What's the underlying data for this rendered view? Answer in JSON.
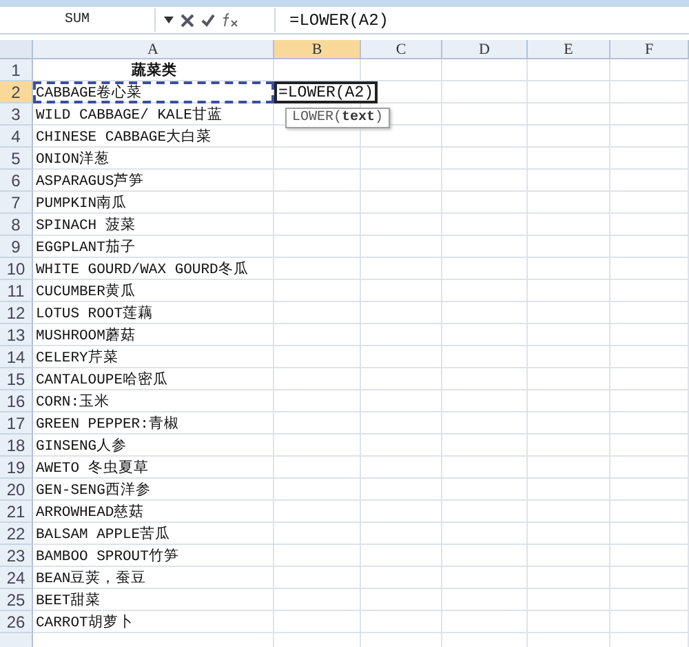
{
  "formula_bar": {
    "name_box": "SUM",
    "formula": "=LOWER(A2)"
  },
  "columns": [
    {
      "label": "A",
      "selected": false
    },
    {
      "label": "B",
      "selected": true
    },
    {
      "label": "C",
      "selected": false
    },
    {
      "label": "D",
      "selected": false
    },
    {
      "label": "E",
      "selected": false
    },
    {
      "label": "F",
      "selected": false
    }
  ],
  "rows": [
    {
      "number": "1",
      "selected": false,
      "referenced": false,
      "a": "蔬菜类",
      "heading": true
    },
    {
      "number": "2",
      "selected": true,
      "referenced": true,
      "a": "CABBAGE卷心菜",
      "b": "=LOWER(A2)",
      "heading": false
    },
    {
      "number": "3",
      "selected": false,
      "referenced": false,
      "a": "WILD CABBAGE/ KALE甘蓝",
      "heading": false
    },
    {
      "number": "4",
      "selected": false,
      "referenced": false,
      "a": "CHINESE CABBAGE大白菜",
      "heading": false
    },
    {
      "number": "5",
      "selected": false,
      "referenced": false,
      "a": "ONION洋葱",
      "heading": false
    },
    {
      "number": "6",
      "selected": false,
      "referenced": false,
      "a": "ASPARAGUS芦笋",
      "heading": false
    },
    {
      "number": "7",
      "selected": false,
      "referenced": false,
      "a": "PUMPKIN南瓜",
      "heading": false
    },
    {
      "number": "8",
      "selected": false,
      "referenced": false,
      "a": "SPINACH 菠菜",
      "heading": false
    },
    {
      "number": "9",
      "selected": false,
      "referenced": false,
      "a": "EGGPLANT茄子",
      "heading": false
    },
    {
      "number": "10",
      "selected": false,
      "referenced": false,
      "a": "WHITE GOURD/WAX GOURD冬瓜",
      "heading": false
    },
    {
      "number": "11",
      "selected": false,
      "referenced": false,
      "a": "CUCUMBER黄瓜",
      "heading": false
    },
    {
      "number": "12",
      "selected": false,
      "referenced": false,
      "a": "LOTUS ROOT莲藕",
      "heading": false
    },
    {
      "number": "13",
      "selected": false,
      "referenced": false,
      "a": "MUSHROOM蘑菇",
      "heading": false
    },
    {
      "number": "14",
      "selected": false,
      "referenced": false,
      "a": "CELERY芹菜",
      "heading": false
    },
    {
      "number": "15",
      "selected": false,
      "referenced": false,
      "a": "CANTALOUPE哈密瓜",
      "heading": false
    },
    {
      "number": "16",
      "selected": false,
      "referenced": false,
      "a": "CORN:玉米",
      "heading": false
    },
    {
      "number": "17",
      "selected": false,
      "referenced": false,
      "a": "GREEN PEPPER:青椒",
      "heading": false
    },
    {
      "number": "18",
      "selected": false,
      "referenced": false,
      "a": "GINSENG人参",
      "heading": false
    },
    {
      "number": "19",
      "selected": false,
      "referenced": false,
      "a": "AWETO 冬虫夏草",
      "heading": false
    },
    {
      "number": "20",
      "selected": false,
      "referenced": false,
      "a": "GEN-SENG西洋参",
      "heading": false
    },
    {
      "number": "21",
      "selected": false,
      "referenced": false,
      "a": "ARROWHEAD慈菇",
      "heading": false
    },
    {
      "number": "22",
      "selected": false,
      "referenced": false,
      "a": "BALSAM APPLE苦瓜",
      "heading": false
    },
    {
      "number": "23",
      "selected": false,
      "referenced": false,
      "a": "BAMBOO SPROUT竹笋",
      "heading": false
    },
    {
      "number": "24",
      "selected": false,
      "referenced": false,
      "a": "BEAN豆荚，蚕豆",
      "heading": false
    },
    {
      "number": "25",
      "selected": false,
      "referenced": false,
      "a": "BEET甜菜",
      "heading": false
    },
    {
      "number": "26",
      "selected": false,
      "referenced": false,
      "a": "CARROT胡萝卜",
      "heading": false
    }
  ],
  "tooltip": "LOWER(**text**)"
}
